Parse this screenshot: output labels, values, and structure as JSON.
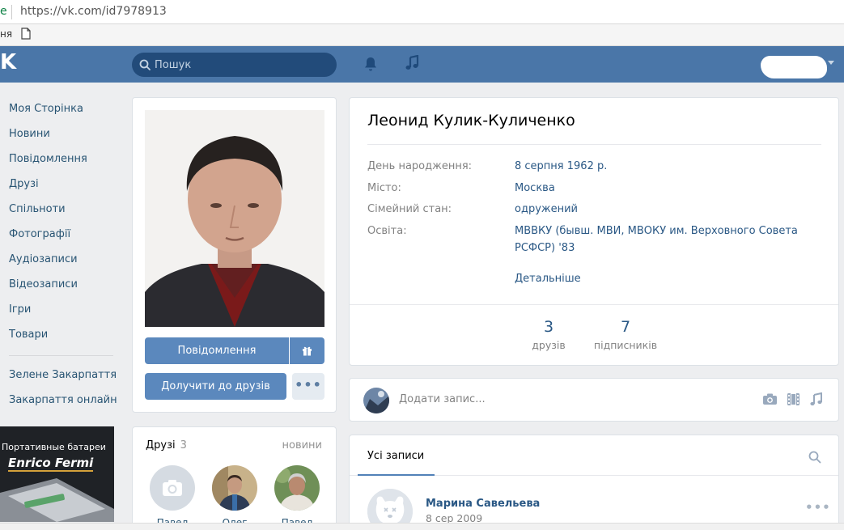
{
  "browser": {
    "url_prefix": "e",
    "url": "https://vk.com/id7978913",
    "bookmark_text": "ня"
  },
  "header": {
    "logo": "K",
    "search_placeholder": "Пошук"
  },
  "nav": {
    "items": [
      "Моя Сторінка",
      "Новини",
      "Повідомлення",
      "Друзі",
      "Спільноти",
      "Фотографії",
      "Аудіозаписи",
      "Відеозаписи",
      "Ігри",
      "Товари"
    ],
    "groups": [
      "Зелене Закарпаття",
      "Закарпаття онлайн"
    ]
  },
  "ad": {
    "line1": "Портативные батареи",
    "line2": "Enrico Fermi"
  },
  "profile": {
    "name": "Леонид Кулик-Куличенко",
    "rows": [
      {
        "label": "День народження:",
        "value": "8 серпня 1962 р."
      },
      {
        "label": "Місто:",
        "value": "Москва"
      },
      {
        "label": "Сімейний стан:",
        "value": "одружений"
      },
      {
        "label": "Освіта:",
        "value": "МВВКУ (бывш. МВИ, МВОКУ им. Верховного Совета РСФСР) '83"
      }
    ],
    "more_link": "Детальніше",
    "stats": [
      {
        "num": "3",
        "label": "друзів"
      },
      {
        "num": "7",
        "label": "підписників"
      }
    ]
  },
  "actions": {
    "message": "Повідомлення",
    "add_friend": "Долучити до друзів",
    "more": "•••"
  },
  "friends": {
    "title": "Друзі",
    "count": "3",
    "news": "новини",
    "names": [
      "Павел",
      "Олег",
      "Павел"
    ]
  },
  "post_box": {
    "placeholder": "Додати запис..."
  },
  "wall": {
    "tab": "Усі записи",
    "post_author": "Марина Савельева",
    "post_date": "8 сер 2009",
    "more": "•••"
  },
  "colors": {
    "header_bg": "#4a76a8",
    "button_bg": "#5b88bd",
    "link": "#2a5885"
  }
}
